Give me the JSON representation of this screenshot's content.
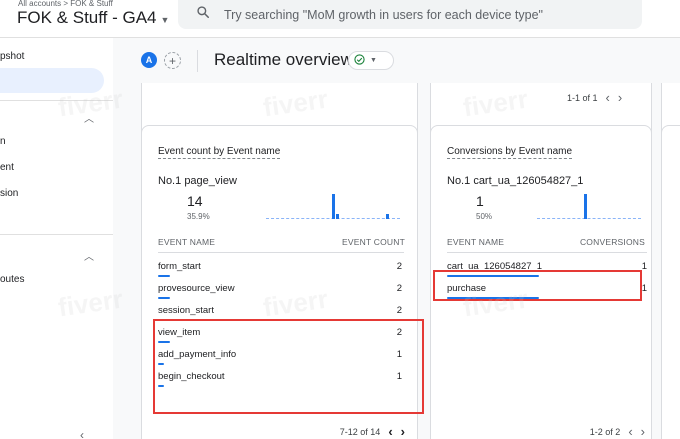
{
  "header": {
    "breadcrumb": "All accounts > FOK & Stuff",
    "property_name": "FOK & Stuff - GA4",
    "search_placeholder": "Try searching \"MoM growth in users for each device type\""
  },
  "sidebar": {
    "items": [
      "pshot",
      "n",
      "ent",
      "sion",
      "outes"
    ]
  },
  "toolbar": {
    "avatar_letter": "A",
    "add_label": "+",
    "page_title": "Realtime overview"
  },
  "top_cards": {
    "left_pager": "1-1 of 1"
  },
  "event_card": {
    "title": "Event count by Event name",
    "top_rank": "No.1",
    "top_name": "page_view",
    "top_value": "14",
    "top_percent": "35.9%",
    "col_name": "EVENT NAME",
    "col_value": "EVENT COUNT",
    "rows": [
      {
        "name": "form_start",
        "value": "2",
        "share": 1.0
      },
      {
        "name": "provesource_view",
        "value": "2",
        "share": 1.0
      },
      {
        "name": "session_start",
        "value": "2",
        "share": 1.0
      },
      {
        "name": "view_item",
        "value": "2",
        "share": 1.0
      },
      {
        "name": "add_payment_info",
        "value": "1",
        "share": 0.5
      },
      {
        "name": "begin_checkout",
        "value": "1",
        "share": 0.5
      }
    ],
    "pager": "7-12 of 14"
  },
  "conversion_card": {
    "title": "Conversions by Event name",
    "top_rank": "No.1",
    "top_name": "cart_ua_126054827_1",
    "top_value": "1",
    "top_percent": "50%",
    "col_name": "EVENT NAME",
    "col_value": "CONVERSIONS",
    "rows": [
      {
        "name": "cart_ua_126054827_1",
        "value": "1",
        "share": 1.0
      },
      {
        "name": "purchase",
        "value": "1",
        "share": 1.0
      }
    ],
    "pager": "1-2 of 2"
  },
  "watermark": "fiverr",
  "colors": {
    "accent": "#1a73e8",
    "highlight": "#e53935",
    "status_ok": "#188038"
  }
}
